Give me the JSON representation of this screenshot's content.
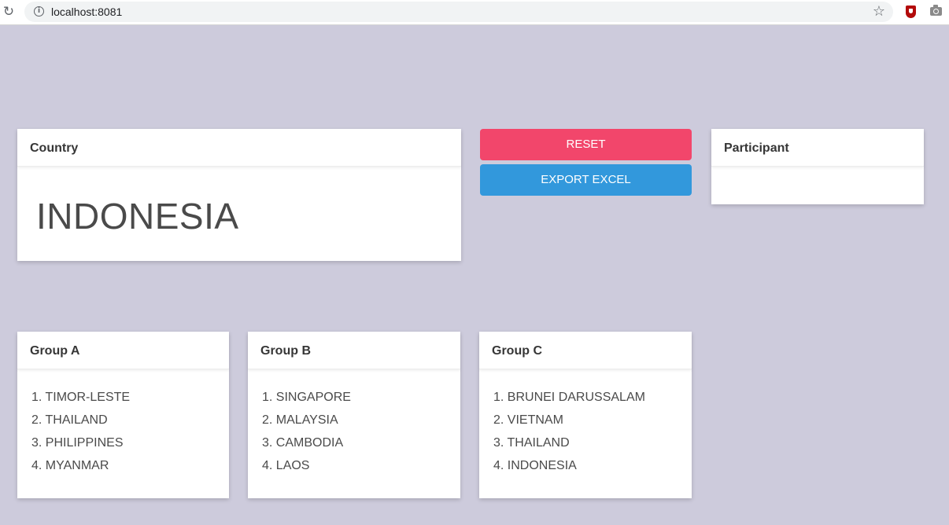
{
  "browser": {
    "url": "localhost:8081"
  },
  "country": {
    "header": "Country",
    "value": "INDONESIA"
  },
  "buttons": {
    "reset": "RESET",
    "export": "EXPORT EXCEL",
    "reset_color": "#f2466b",
    "export_color": "#3298dc"
  },
  "participant": {
    "header": "Participant"
  },
  "groups": [
    {
      "header": "Group A",
      "items": [
        "1. TIMOR-LESTE",
        "2. THAILAND",
        "3. PHILIPPINES",
        "4. MYANMAR"
      ]
    },
    {
      "header": "Group B",
      "items": [
        "1. SINGAPORE",
        "2. MALAYSIA",
        "3. CAMBODIA",
        "4. LAOS"
      ]
    },
    {
      "header": "Group C",
      "items": [
        "1. BRUNEI DARUSSALAM",
        "2. VIETNAM",
        "3. THAILAND",
        "4. INDONESIA"
      ]
    }
  ],
  "icons": {
    "reload": "reload-icon",
    "info": "info-icon",
    "bookmark": "star-icon",
    "extension": "shield-icon",
    "screenshot": "camera-icon"
  }
}
